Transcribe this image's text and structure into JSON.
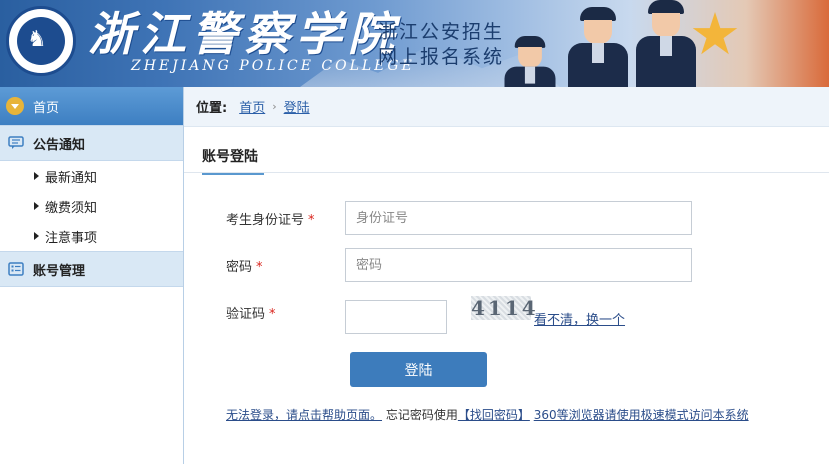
{
  "header": {
    "emblem_text": "ZHEJIANG POLICE COLLEGE 浙江警察学院",
    "title_cn": "浙江警察学院",
    "title_en": "ZHEJIANG POLICE COLLEGE",
    "subtitle_line1": "浙江公安招生",
    "subtitle_line2": "网上报名系统"
  },
  "sidebar": {
    "home": "首页",
    "notice_group": "公告通知",
    "notice_items": [
      "最新通知",
      "缴费须知",
      "注意事项"
    ],
    "account_group": "账号管理"
  },
  "breadcrumb": {
    "label": "位置:",
    "home": "首页",
    "separator": "›",
    "current": "登陆"
  },
  "tab": {
    "title": "账号登陆"
  },
  "form": {
    "id_label": "考生身份证号",
    "id_placeholder": "身份证号",
    "password_label": "密码",
    "password_placeholder": "密码",
    "captcha_label": "验证码",
    "required_mark": "*",
    "captcha_text": "4114",
    "refresh_link": "看不清，换一个",
    "submit_label": "登陆"
  },
  "help": {
    "link1": "无法登录，请点击帮助页面。",
    "text2": "忘记密码使用",
    "link2": "【找回密码】",
    "link3": "360等浏览器请使用极速模式访问本系统"
  },
  "colors": {
    "nav_blue": "#3d7fc2",
    "button_blue": "#3d7cbc",
    "required_red": "#d9241c",
    "link_blue": "#2b4d8a"
  }
}
